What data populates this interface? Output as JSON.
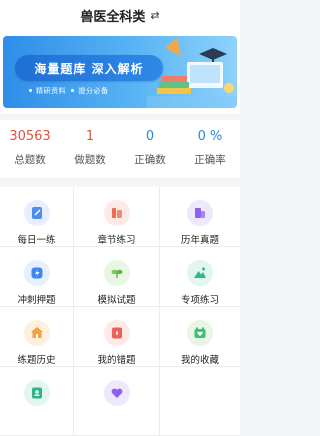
{
  "header": {
    "title": "兽医全科类",
    "switch_icon": "swap-icon"
  },
  "banner": {
    "headline": "海量题库 深入解析",
    "subtitle_1": "精研资料",
    "subtitle_2": "提分必备"
  },
  "stats": [
    {
      "value": "30563",
      "label": "总题数",
      "color": "#e0523f"
    },
    {
      "value": "1",
      "label": "做题数",
      "color": "#e0523f"
    },
    {
      "value": "0",
      "label": "正确数",
      "color": "#2d88e0"
    },
    {
      "value": "0 %",
      "label": "正确率",
      "color": "#2d88e0"
    }
  ],
  "menu": [
    {
      "label": "每日一练",
      "icon": "edit-icon"
    },
    {
      "label": "章节练习",
      "icon": "book-stack-icon"
    },
    {
      "label": "历年真题",
      "icon": "building-icon"
    },
    {
      "label": "冲刺押题",
      "icon": "lightning-icon"
    },
    {
      "label": "模拟试题",
      "icon": "sprout-icon"
    },
    {
      "label": "专项练习",
      "icon": "mountain-icon"
    },
    {
      "label": "练题历史",
      "icon": "house-history-icon"
    },
    {
      "label": "我的错题",
      "icon": "error-note-icon"
    },
    {
      "label": "我的收藏",
      "icon": "favorite-folder-icon"
    },
    {
      "label": "",
      "icon": "user-card-icon"
    },
    {
      "label": "",
      "icon": "heart-icon"
    }
  ]
}
